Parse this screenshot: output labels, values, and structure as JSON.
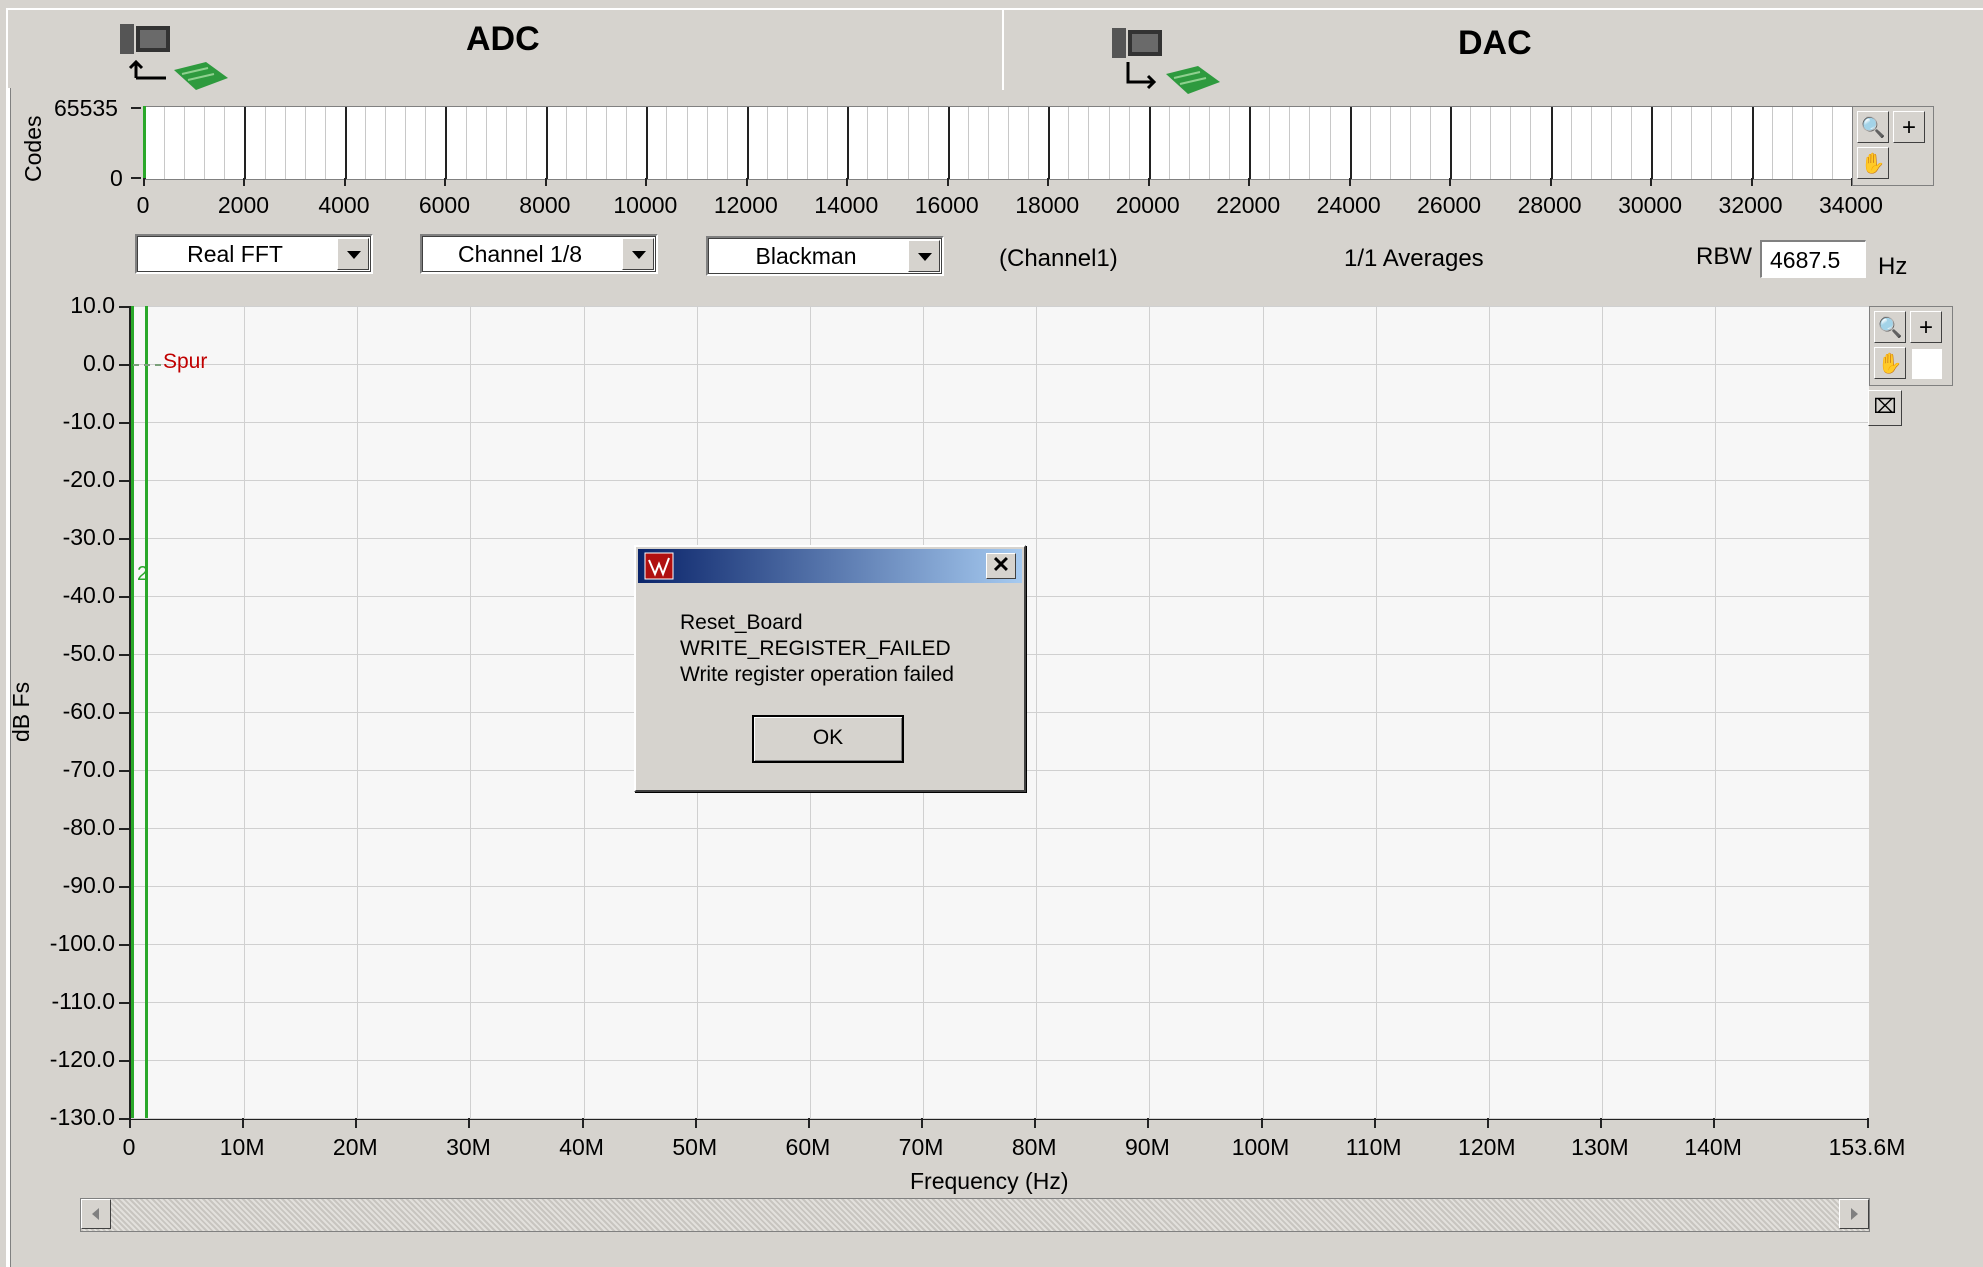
{
  "tabs": [
    {
      "label": "ADC",
      "icon": "computer-to-board-upload-icon"
    },
    {
      "label": "DAC",
      "icon": "computer-to-board-download-icon"
    }
  ],
  "strip_chart": {
    "ylabel": "Codes",
    "y_ticks": [
      "65535",
      "0"
    ],
    "x_ticks": [
      "0",
      "2000",
      "4000",
      "6000",
      "8000",
      "10000",
      "12000",
      "14000",
      "16000",
      "18000",
      "20000",
      "22000",
      "24000",
      "26000",
      "28000",
      "30000",
      "32000",
      "34000"
    ],
    "x_range": [
      0,
      34000
    ],
    "y_range": [
      0,
      65535
    ]
  },
  "controls": {
    "fft_type": "Real FFT",
    "channel": "Channel 1/8",
    "window": "Blackman",
    "channel_label": "(Channel1)",
    "averages": "1/1 Averages",
    "rbw_label": "RBW",
    "rbw_value": "4687.5",
    "rbw_unit": "Hz"
  },
  "chart_data": {
    "type": "line",
    "ylabel": "dB Fs",
    "xlabel": "Frequency (Hz)",
    "y_ticks": [
      "10.0",
      "0.0",
      "-10.0",
      "-20.0",
      "-30.0",
      "-40.0",
      "-50.0",
      "-60.0",
      "-70.0",
      "-80.0",
      "-90.0",
      "-100.0",
      "-110.0",
      "-120.0",
      "-130.0"
    ],
    "x_ticks": [
      "0",
      "10M",
      "20M",
      "30M",
      "40M",
      "50M",
      "60M",
      "70M",
      "80M",
      "90M",
      "100M",
      "110M",
      "120M",
      "130M",
      "140M",
      "153.6M"
    ],
    "ylim": [
      -130,
      10
    ],
    "xlim": [
      0,
      153600000
    ],
    "grid": true,
    "annotations": [
      {
        "text": "Spur",
        "color": "#c00000",
        "y": 0
      },
      {
        "text": "2",
        "color": "#2aa82a",
        "y": -35
      }
    ],
    "series": [
      {
        "color": "#2aa82a",
        "x": [
          0,
          0
        ],
        "y": [
          -130,
          10
        ]
      },
      {
        "color": "#2aa82a",
        "x": [
          1200000,
          1200000
        ],
        "y": [
          -130,
          10
        ]
      }
    ]
  },
  "dialog": {
    "lines": [
      "Reset_Board",
      "WRITE_REGISTER_FAILED",
      "Write register operation failed"
    ],
    "ok_label": "OK",
    "close_glyph": "✕"
  },
  "palettes": {
    "zoom_glyph": "🔍",
    "plus_glyph": "+",
    "hand_glyph": "✋"
  }
}
